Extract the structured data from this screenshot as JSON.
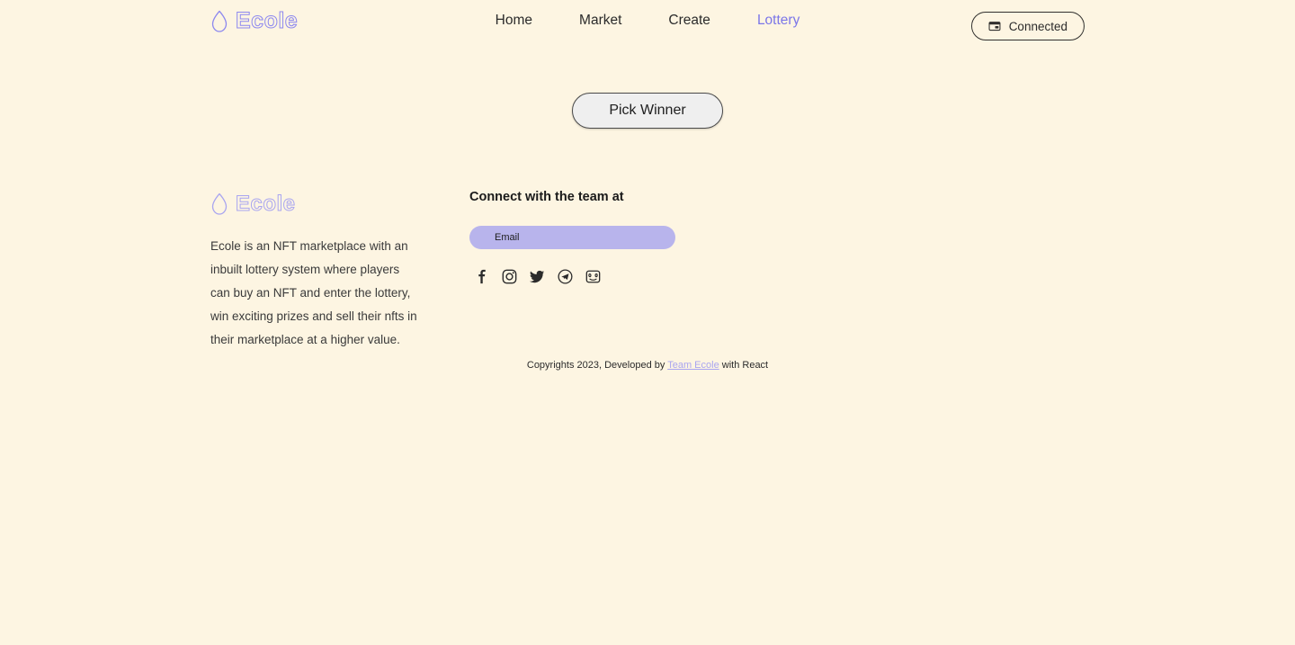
{
  "theme": {
    "background": "#fdf5e2",
    "accent": "#7b76e8",
    "logo_stroke": "#8d88ef",
    "footer_logo_stroke": "#a9a5f0",
    "email_field_bg": "#b8b4ec",
    "button_bg": "#efefef",
    "text": "#2b2b2b"
  },
  "header": {
    "brand": {
      "name": "Ecole",
      "icon": "droplet-icon"
    },
    "nav": [
      {
        "label": "Home",
        "active": false
      },
      {
        "label": "Market",
        "active": false
      },
      {
        "label": "Create",
        "active": false
      },
      {
        "label": "Lottery",
        "active": true
      }
    ],
    "wallet_button": {
      "label": "Connected",
      "icon": "wallet-icon"
    }
  },
  "main": {
    "pick_winner_label": "Pick Winner"
  },
  "footer": {
    "brand": {
      "name": "Ecole",
      "icon": "droplet-icon"
    },
    "description": "Ecole is an NFT marketplace with an inbuilt lottery system where players can buy an NFT and enter the lottery, win exciting prizes and sell their nfts in their marketplace at a higher value.",
    "connect_title": "Connect with the team at",
    "email": {
      "placeholder": "Email",
      "value": ""
    },
    "socials": [
      {
        "name": "facebook-icon",
        "label": "Facebook"
      },
      {
        "name": "instagram-icon",
        "label": "Instagram"
      },
      {
        "name": "twitter-icon",
        "label": "Twitter"
      },
      {
        "name": "telegram-icon",
        "label": "Telegram"
      },
      {
        "name": "discord-icon",
        "label": "Discord"
      }
    ],
    "copyright": {
      "prefix": "Copyrights 2023, Developed by ",
      "link": "Team Ecole",
      "suffix": " with React"
    }
  }
}
